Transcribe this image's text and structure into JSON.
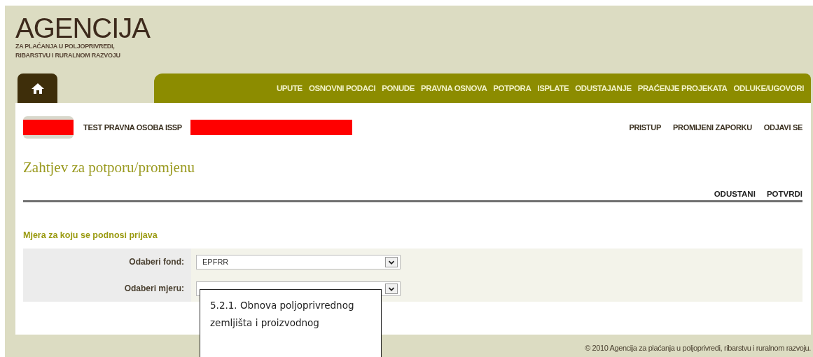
{
  "logo": {
    "title": "AGENCIJA",
    "subtitle_lines": [
      "ZA PLAĆANJA U POLJOPRIVREDI,",
      "RIBARSTVU I RURALNOM RAZVOJU"
    ]
  },
  "nav": {
    "items": [
      "UPUTE",
      "OSNOVNI PODACI",
      "PONUDE",
      "PRAVNA OSNOVA",
      "POTPORA",
      "ISPLATE",
      "ODUSTAJANJE",
      "PRAĆENJE PROJEKATA",
      "ODLUKE/UGOVORI"
    ]
  },
  "user": {
    "name": "TEST PRAVNA OSOBA ISSP",
    "links": [
      "PRISTUP",
      "PROMIJENI ZAPORKU",
      "ODJAVI SE"
    ]
  },
  "page_title": "Zahtjev za potporu/promjenu",
  "actions": [
    "ODUSTANI",
    "POTVRDI"
  ],
  "section": {
    "heading": "Mjera za koju se podnosi prijava",
    "fields": [
      {
        "label": "Odaberi fond:",
        "value": "EPFRR"
      },
      {
        "label": "Odaberi mjeru:"
      }
    ]
  },
  "tooltip": "5.2.1. Obnova poljoprivrednog zemljišta i proizvodnog",
  "footer": "© 2010 Agencija za plaćanja u poljoprivredi, ribarstvu i ruralnom razvoju."
}
